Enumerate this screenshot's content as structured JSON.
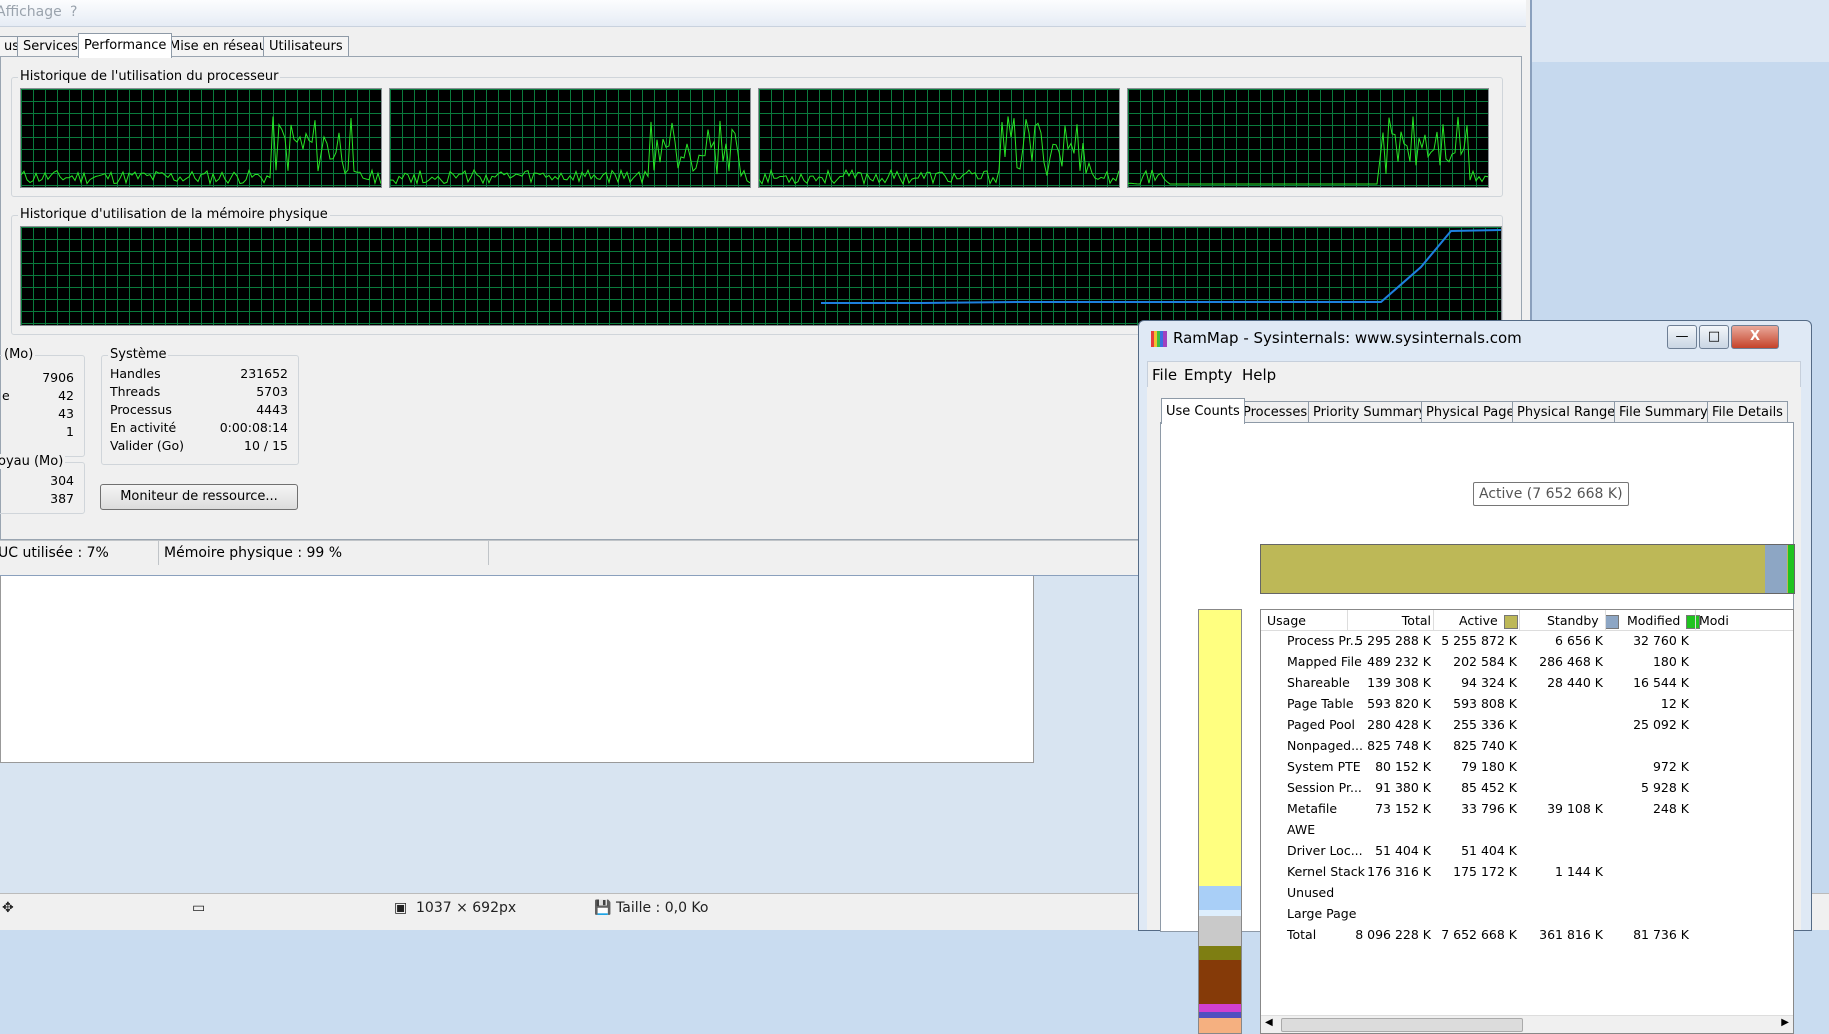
{
  "taskmgr": {
    "menu": [
      "Affichage",
      "?"
    ],
    "tabs": [
      "us",
      "Services",
      "Performance",
      "Mise en réseau",
      "Utilisateurs"
    ],
    "cpu_history_title": "Historique de l'utilisation du processeur",
    "mem_history_title": "Historique d'utilisation de la mémoire physique",
    "phys_mem_title": "(Mo)",
    "phys_mem_values": [
      "7906",
      "42",
      "43",
      "1"
    ],
    "phys_mem_labels": [
      "",
      "e",
      "",
      ""
    ],
    "kernel_title": "oyau (Mo)",
    "kernel_values": [
      "304",
      "387"
    ],
    "system_title": "Système",
    "system_rows": [
      {
        "label": "Handles",
        "value": "231652"
      },
      {
        "label": "Threads",
        "value": "5703"
      },
      {
        "label": "Processus",
        "value": "4443"
      },
      {
        "label": "En activité",
        "value": "0:00:08:14"
      },
      {
        "label": "Valider (Go)",
        "value": "10 / 15"
      }
    ],
    "resource_button": "Moniteur de ressource...",
    "status_cpu": "UC utilisée : 7%",
    "status_mem": "Mémoire physique : 99 %",
    "colors": {
      "graph_bg": "#000000",
      "grid": "#0a7a3c",
      "cpu_line": "#27e427",
      "mem_line": "#1e7fe0"
    }
  },
  "editor_status": {
    "dimensions": "1037 × 692px",
    "size": "Taille : 0,0 Ko"
  },
  "rammap": {
    "title": "RamMap - Sysinternals: www.sysinternals.com",
    "window_buttons": {
      "minimize": "—",
      "maximize": "□",
      "close": "X"
    },
    "menu": [
      "File",
      "Empty",
      "Help"
    ],
    "tabs": [
      "Use Counts",
      "Processes",
      "Priority Summary",
      "Physical Pages",
      "Physical Ranges",
      "File Summary",
      "File Details"
    ],
    "tooltip": "Active (7 652 668 K)",
    "headers": [
      "Usage",
      "Total",
      "Active",
      "Standby",
      "Modified",
      "Modi"
    ],
    "header_colors": {
      "active": "#bdb857",
      "standby": "#8da6c4",
      "modified": "#1fc31f"
    },
    "rows": [
      {
        "usage": "Process Pr...",
        "total": "5 295 288 K",
        "active": "5 255 872 K",
        "standby": "6 656 K",
        "modified": "32 760 K"
      },
      {
        "usage": "Mapped File",
        "total": "489 232 K",
        "active": "202 584 K",
        "standby": "286 468 K",
        "modified": "180 K"
      },
      {
        "usage": "Shareable",
        "total": "139 308 K",
        "active": "94 324 K",
        "standby": "28 440 K",
        "modified": "16 544 K"
      },
      {
        "usage": "Page Table",
        "total": "593 820 K",
        "active": "593 808 K",
        "standby": "",
        "modified": "12 K"
      },
      {
        "usage": "Paged Pool",
        "total": "280 428 K",
        "active": "255 336 K",
        "standby": "",
        "modified": "25 092 K"
      },
      {
        "usage": "Nonpaged...",
        "total": "825 748 K",
        "active": "825 740 K",
        "standby": "",
        "modified": ""
      },
      {
        "usage": "System PTE",
        "total": "80 152 K",
        "active": "79 180 K",
        "standby": "",
        "modified": "972 K"
      },
      {
        "usage": "Session Pr...",
        "total": "91 380 K",
        "active": "85 452 K",
        "standby": "",
        "modified": "5 928 K"
      },
      {
        "usage": "Metafile",
        "total": "73 152 K",
        "active": "33 796 K",
        "standby": "39 108 K",
        "modified": "248 K"
      },
      {
        "usage": "AWE",
        "total": "",
        "active": "",
        "standby": "",
        "modified": ""
      },
      {
        "usage": "Driver Loc...",
        "total": "51 404 K",
        "active": "51 404 K",
        "standby": "",
        "modified": ""
      },
      {
        "usage": "Kernel Stack",
        "total": "176 316 K",
        "active": "175 172 K",
        "standby": "1 144 K",
        "modified": ""
      },
      {
        "usage": "Unused",
        "total": "",
        "active": "",
        "standby": "",
        "modified": ""
      },
      {
        "usage": "Large Page",
        "total": "",
        "active": "",
        "standby": "",
        "modified": ""
      },
      {
        "usage": "Total",
        "total": "8 096 228 K",
        "active": "7 652 668 K",
        "standby": "361 816 K",
        "modified": "81 736 K"
      }
    ]
  }
}
